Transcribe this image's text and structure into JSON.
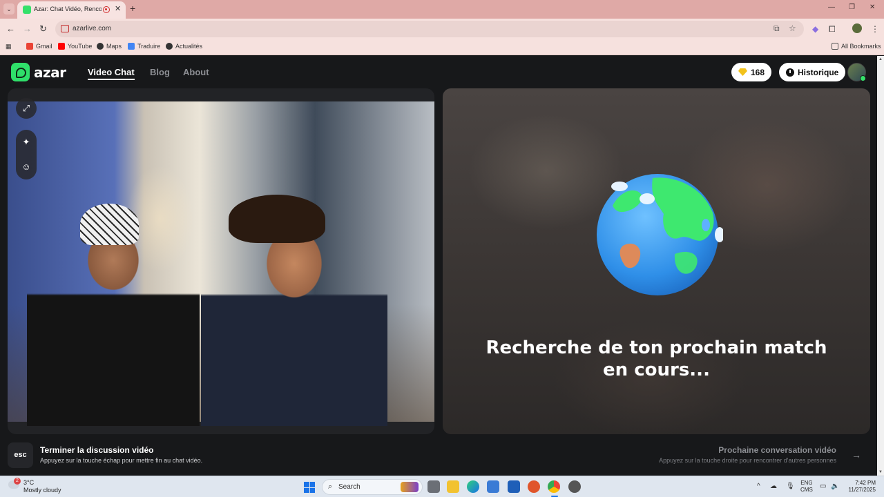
{
  "browser": {
    "tab_title": "Azar: Chat Vidéo, Rencontr",
    "url": "azarlive.com",
    "bookmarks": [
      "Gmail",
      "YouTube",
      "Maps",
      "Traduire",
      "Actualités"
    ],
    "all_bookmarks": "All Bookmarks"
  },
  "app": {
    "logo_text": "azar",
    "nav": [
      "Video Chat",
      "Blog",
      "About"
    ],
    "gems": "168",
    "history_label": "Historique",
    "status_text": "Recherche de ton prochain match en cours...",
    "accent_color": "#2fe06a"
  },
  "footer": {
    "esc_key": "esc",
    "end_title": "Terminer la discussion vidéo",
    "end_sub": "Appuyez sur la touche échap pour mettre fin au chat vidéo.",
    "next_title": "Prochaine conversation vidéo",
    "next_sub": "Appuyez sur la touche droite pour rencontrer d'autres personnes"
  },
  "taskbar": {
    "temperature": "3°C",
    "condition": "Mostly cloudy",
    "weather_badge": "2",
    "search_label": "Search",
    "lang_1": "ENG",
    "lang_2": "CMS",
    "time": "7:42 PM",
    "date": "11/27/2025"
  }
}
